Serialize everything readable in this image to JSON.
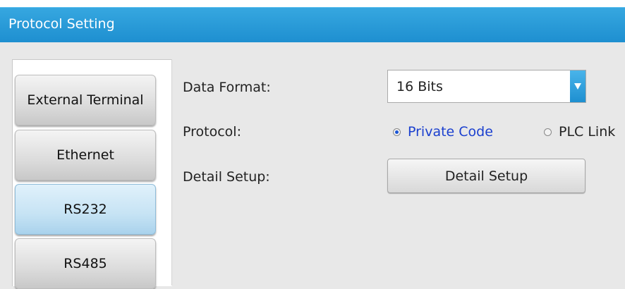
{
  "window": {
    "title": "Protocol Setting"
  },
  "sidebar": {
    "items": [
      {
        "label": "External Terminal"
      },
      {
        "label": "Ethernet"
      },
      {
        "label": "RS232",
        "selected": true
      },
      {
        "label": "RS485"
      }
    ]
  },
  "form": {
    "data_format": {
      "label": "Data Format:",
      "value": "16 Bits"
    },
    "protocol": {
      "label": "Protocol:",
      "options": [
        {
          "label": "Private Code",
          "checked": true
        },
        {
          "label": "PLC Link",
          "checked": false
        }
      ]
    },
    "detail_setup": {
      "label": "Detail Setup:",
      "button_label": "Detail Setup"
    }
  },
  "colors": {
    "titlebar": "#1e8fd0",
    "selected_tab": "#c6e3f4",
    "selected_radio_text": "#1a3fcf"
  }
}
